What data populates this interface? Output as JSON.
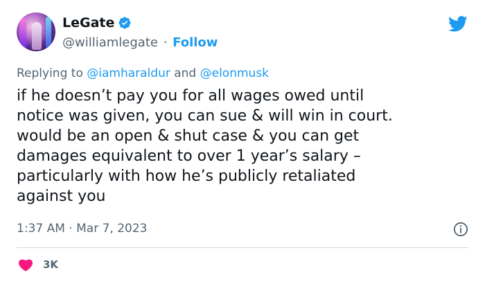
{
  "author": {
    "name": "LeGate",
    "handle": "@williamlegate",
    "separator": "·",
    "follow_label": "Follow"
  },
  "reply": {
    "prefix": "Replying to",
    "mention1": "@iamharaldur",
    "conjunction": "and",
    "mention2": "@elonmusk"
  },
  "tweet": {
    "text": "if he doesn’t pay you for all wages owed until\nnotice was given, you can sue & will win in court.\nwould be an open & shut case & you can get\ndamages equivalent to over 1 year’s salary –\nparticularly with how he’s publicly retaliated\nagainst you"
  },
  "meta": {
    "time": "1:37 AM",
    "separator": "·",
    "date": "Mar 7, 2023"
  },
  "engagement": {
    "likes": "3K"
  },
  "icons": {
    "verified": "verified-badge-icon",
    "logo": "twitter-bird-icon",
    "info": "info-icon",
    "heart": "heart-icon"
  },
  "colors": {
    "accent": "#1d9bf0",
    "text": "#0f1419",
    "secondary": "#536471",
    "heart": "#f91880"
  }
}
